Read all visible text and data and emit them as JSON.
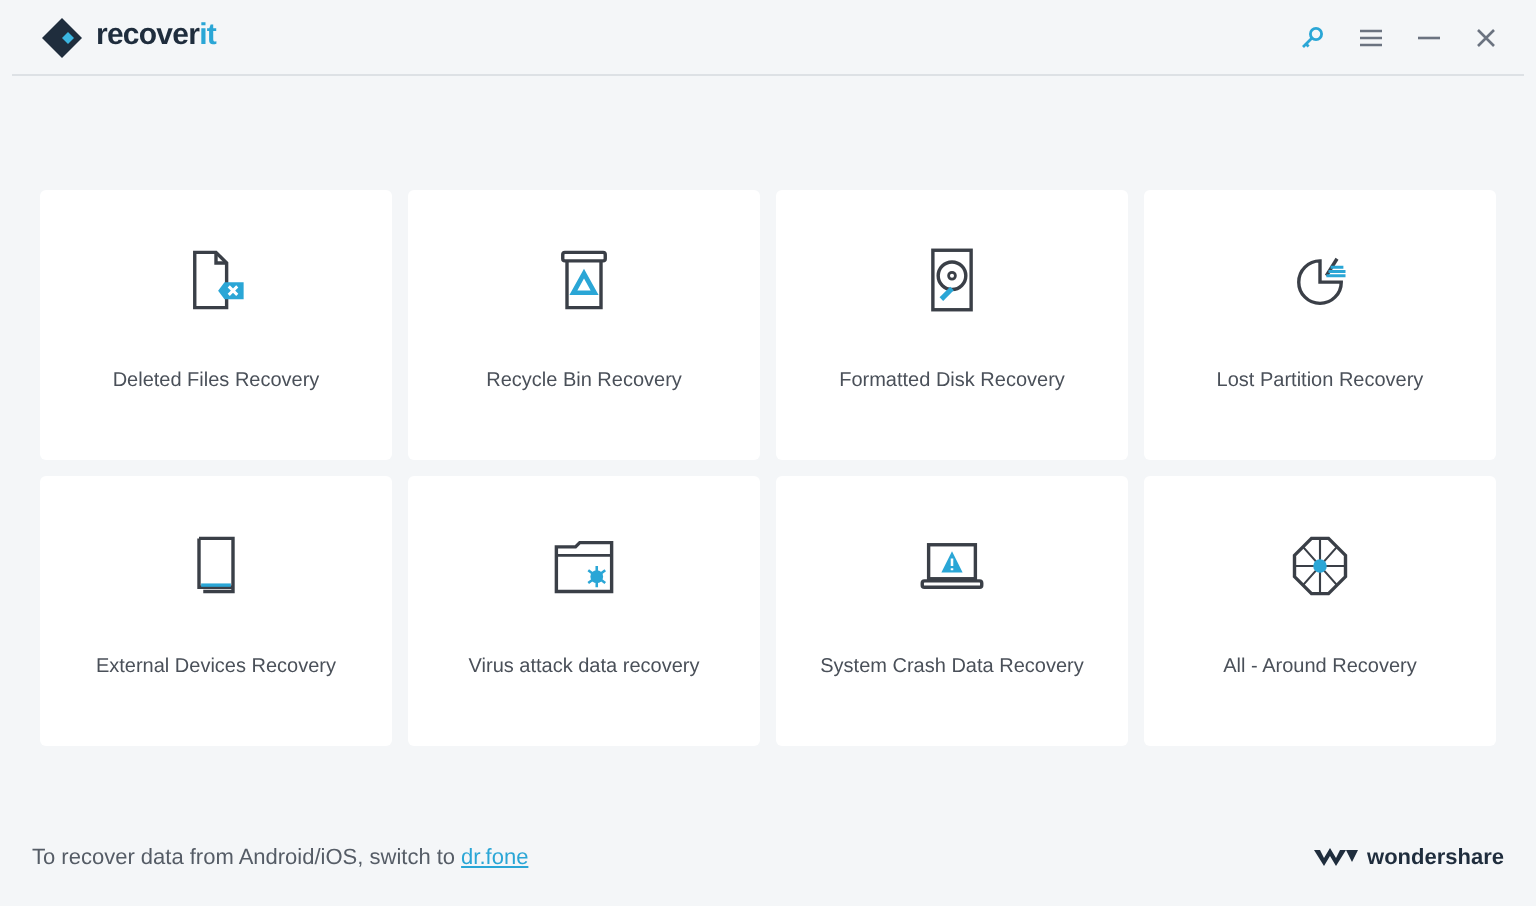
{
  "app": {
    "logo_text": "recover",
    "logo_accent": "it"
  },
  "cards": [
    {
      "kind": "deleted",
      "label": "Deleted Files Recovery"
    },
    {
      "kind": "recycle",
      "label": "Recycle Bin Recovery"
    },
    {
      "kind": "disk",
      "label": "Formatted Disk Recovery"
    },
    {
      "kind": "partition",
      "label": "Lost Partition Recovery"
    },
    {
      "kind": "external",
      "label": "External Devices Recovery"
    },
    {
      "kind": "virus",
      "label": "Virus attack data recovery"
    },
    {
      "kind": "crash",
      "label": "System Crash Data Recovery"
    },
    {
      "kind": "all",
      "label": "All - Around Recovery"
    }
  ],
  "footer": {
    "text": "To recover data from Android/iOS, switch to",
    "link": "dr.fone",
    "brand": "wondershare"
  }
}
